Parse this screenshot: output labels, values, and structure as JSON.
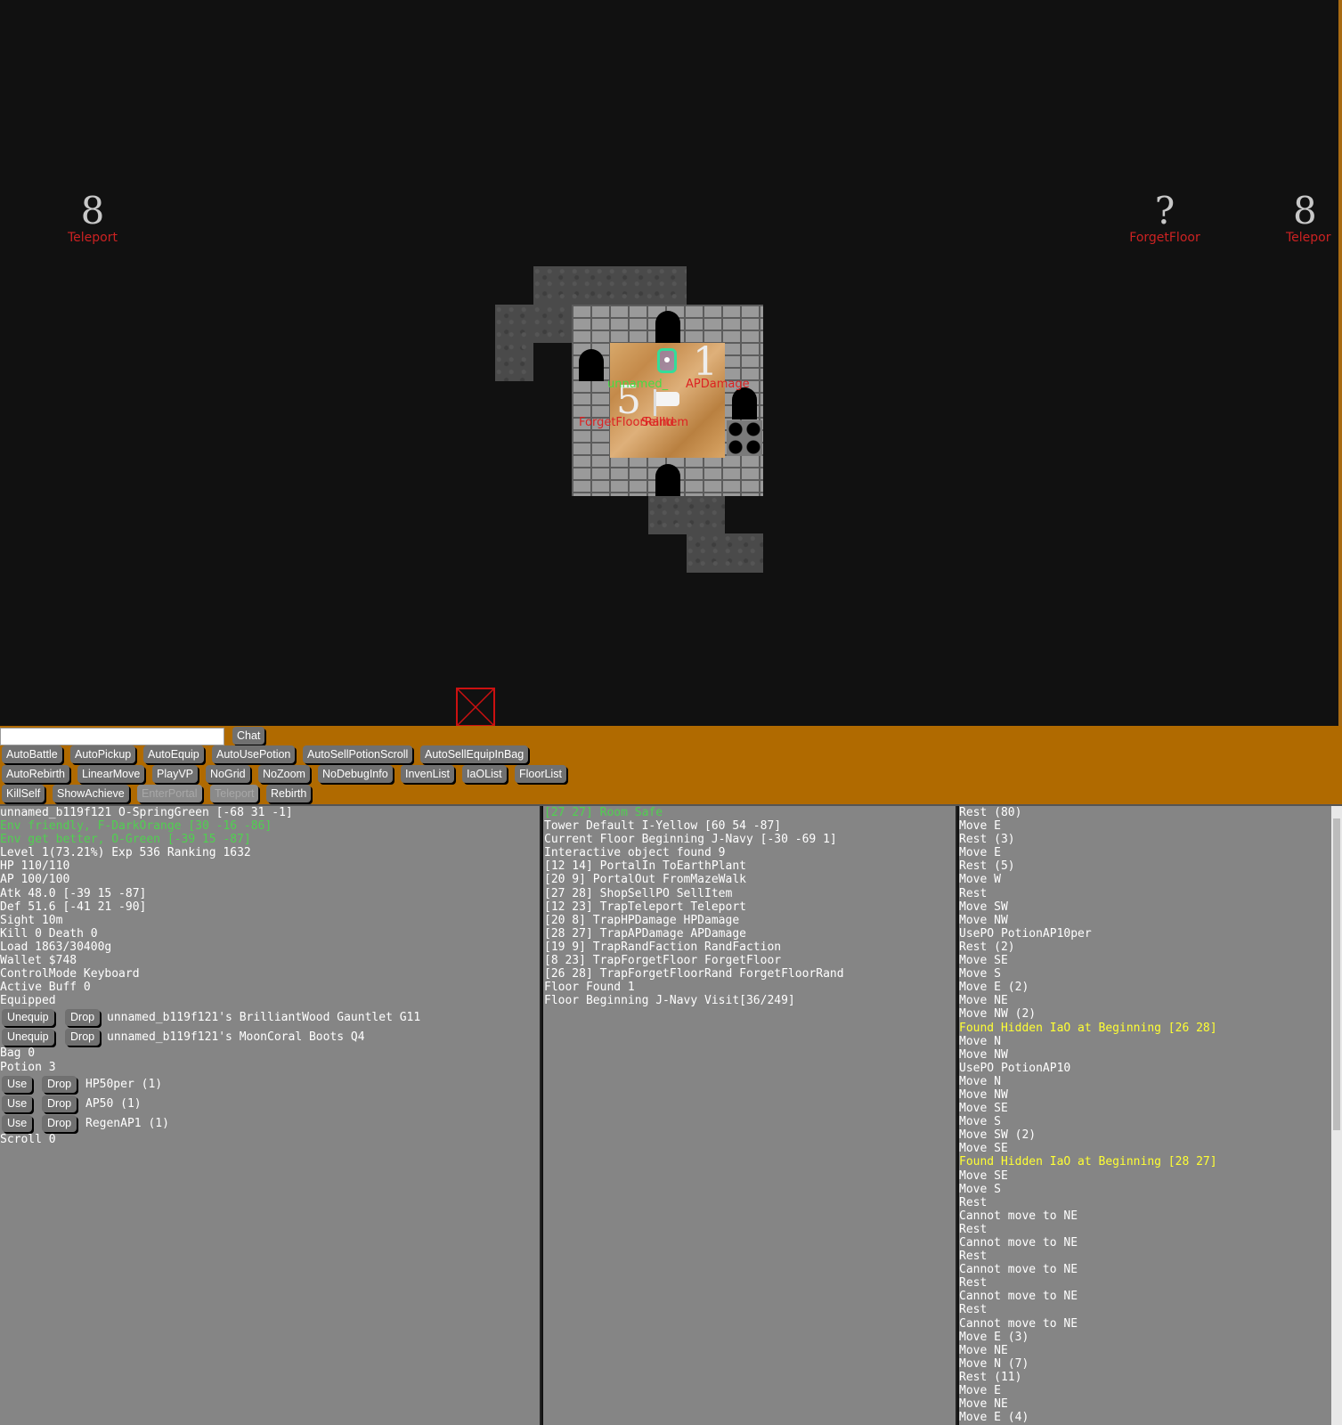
{
  "map": {
    "floor_markers": [
      {
        "glyph": "8",
        "label": "Teleport"
      },
      {
        "glyph": "?",
        "label": "ForgetFloor"
      },
      {
        "glyph": "8",
        "label": "Telepor"
      }
    ],
    "room_labels": {
      "player_name": "unnamed_",
      "trap_ap": "APDamage",
      "trap_floor": "ForgetFloorRand",
      "shop": "SellItem",
      "num_left": "5",
      "num_right": "1"
    }
  },
  "chat": {
    "placeholder": "",
    "button": "Chat"
  },
  "toolbar": {
    "row1": [
      "AutoBattle",
      "AutoPickup",
      "AutoEquip",
      "AutoUsePotion",
      "AutoSellPotionScroll",
      "AutoSellEquipInBag"
    ],
    "row2": [
      "AutoRebirth",
      "LinearMove",
      "PlayVP",
      "NoGrid",
      "NoZoom",
      "NoDebugInfo",
      "InvenList",
      "IaOList",
      "FloorList"
    ],
    "row3": [
      "KillSelf",
      "ShowAchieve",
      "EnterPortal",
      "Teleport",
      "Rebirth"
    ]
  },
  "status": {
    "lines_top": [
      {
        "text": "unnamed_b119f121 O-SpringGreen [-68 31 -1]",
        "color": "white"
      },
      {
        "text": "Env friendly, F-DarkOrange [30 -16 -86]",
        "color": "green"
      },
      {
        "text": "Env get better, O-Green [-39 15 -87]",
        "color": "green"
      },
      {
        "text": "Level 1(73.21%) Exp 536 Ranking 1632",
        "color": "white"
      },
      {
        "text": "HP 110/110",
        "color": "white"
      },
      {
        "text": "AP 100/100",
        "color": "white"
      },
      {
        "text": "Atk 48.0 [-39 15 -87]",
        "color": "white"
      },
      {
        "text": "Def 51.6 [-41 21 -90]",
        "color": "white"
      },
      {
        "text": "Sight 10m",
        "color": "white"
      },
      {
        "text": "Kill 0 Death 0",
        "color": "white"
      },
      {
        "text": "Load 1863/30400g",
        "color": "white"
      },
      {
        "text": "Wallet $748",
        "color": "white"
      },
      {
        "text": "ControlMode Keyboard",
        "color": "white"
      },
      {
        "text": "Active Buff 0",
        "color": "white"
      },
      {
        "text": "Equipped",
        "color": "white"
      }
    ],
    "equipped": [
      {
        "btn1": "Unequip",
        "btn2": "Drop",
        "name": "unnamed_b119f121's BrilliantWood Gauntlet G11"
      },
      {
        "btn1": "Unequip",
        "btn2": "Drop",
        "name": "unnamed_b119f121's MoonCoral Boots Q4"
      }
    ],
    "bag": "Bag 0",
    "potion": "Potion 3",
    "potions": [
      {
        "btn1": "Use",
        "btn2": "Drop",
        "name": "HP50per (1)"
      },
      {
        "btn1": "Use",
        "btn2": "Drop",
        "name": "AP50 (1)"
      },
      {
        "btn1": "Use",
        "btn2": "Drop",
        "name": "RegenAP1 (1)"
      }
    ],
    "scroll": "Scroll 0"
  },
  "floor_info": [
    {
      "text": "[27 27] Room Safe",
      "color": "green"
    },
    {
      "text": "Tower Default I-Yellow [60 54 -87]",
      "color": "white"
    },
    {
      "text": "Current Floor Beginning J-Navy [-30 -69 1]",
      "color": "white"
    },
    {
      "text": "Interactive object found 9",
      "color": "white"
    },
    {
      "text": "[12 14] PortalIn ToEarthPlant",
      "color": "white"
    },
    {
      "text": "[20 9] PortalOut FromMazeWalk",
      "color": "white"
    },
    {
      "text": "[27 28] ShopSellPO SellItem",
      "color": "white"
    },
    {
      "text": "[12 23] TrapTeleport Teleport",
      "color": "white"
    },
    {
      "text": "[20 8] TrapHPDamage HPDamage",
      "color": "white"
    },
    {
      "text": "[28 27] TrapAPDamage APDamage",
      "color": "white"
    },
    {
      "text": "[19 9] TrapRandFaction RandFaction",
      "color": "white"
    },
    {
      "text": "[8 23] TrapForgetFloor ForgetFloor",
      "color": "white"
    },
    {
      "text": "[26 28] TrapForgetFloorRand ForgetFloorRand",
      "color": "white"
    },
    {
      "text": "Floor Found 1",
      "color": "white"
    },
    {
      "text": "Floor Beginning J-Navy Visit[36/249]",
      "color": "white"
    }
  ],
  "log": [
    {
      "text": "Rest (80)",
      "color": "white"
    },
    {
      "text": "Move E",
      "color": "white"
    },
    {
      "text": "Rest (3)",
      "color": "white"
    },
    {
      "text": "Move E",
      "color": "white"
    },
    {
      "text": "Rest (5)",
      "color": "white"
    },
    {
      "text": "Move W",
      "color": "white"
    },
    {
      "text": "Rest",
      "color": "white"
    },
    {
      "text": "Move SW",
      "color": "white"
    },
    {
      "text": "Move NW",
      "color": "white"
    },
    {
      "text": "UsePO PotionAP10per",
      "color": "white"
    },
    {
      "text": "Rest (2)",
      "color": "white"
    },
    {
      "text": "Move SE",
      "color": "white"
    },
    {
      "text": "Move S",
      "color": "white"
    },
    {
      "text": "Move E (2)",
      "color": "white"
    },
    {
      "text": "Move NE",
      "color": "white"
    },
    {
      "text": "Move NW (2)",
      "color": "white"
    },
    {
      "text": "Found Hidden IaO at Beginning [26 28]",
      "color": "yellow"
    },
    {
      "text": "Move N",
      "color": "white"
    },
    {
      "text": "Move NW",
      "color": "white"
    },
    {
      "text": "UsePO PotionAP10",
      "color": "white"
    },
    {
      "text": "Move N",
      "color": "white"
    },
    {
      "text": "Move NW",
      "color": "white"
    },
    {
      "text": "Move SE",
      "color": "white"
    },
    {
      "text": "Move S",
      "color": "white"
    },
    {
      "text": "Move SW (2)",
      "color": "white"
    },
    {
      "text": "Move SE",
      "color": "white"
    },
    {
      "text": "Found Hidden IaO at Beginning [28 27]",
      "color": "yellow"
    },
    {
      "text": "Move SE",
      "color": "white"
    },
    {
      "text": "Move S",
      "color": "white"
    },
    {
      "text": "Rest",
      "color": "white"
    },
    {
      "text": "Cannot move to NE",
      "color": "white"
    },
    {
      "text": "Rest",
      "color": "white"
    },
    {
      "text": "Cannot move to NE",
      "color": "white"
    },
    {
      "text": "Rest",
      "color": "white"
    },
    {
      "text": "Cannot move to NE",
      "color": "white"
    },
    {
      "text": "Rest",
      "color": "white"
    },
    {
      "text": "Cannot move to NE",
      "color": "white"
    },
    {
      "text": "Rest",
      "color": "white"
    },
    {
      "text": "Cannot move to NE",
      "color": "white"
    },
    {
      "text": "Move E (3)",
      "color": "white"
    },
    {
      "text": "Move NE",
      "color": "white"
    },
    {
      "text": "Move N (7)",
      "color": "white"
    },
    {
      "text": "Rest (11)",
      "color": "white"
    },
    {
      "text": "Move E",
      "color": "white"
    },
    {
      "text": "Move NE",
      "color": "white"
    },
    {
      "text": "Move E (4)",
      "color": "white"
    }
  ]
}
